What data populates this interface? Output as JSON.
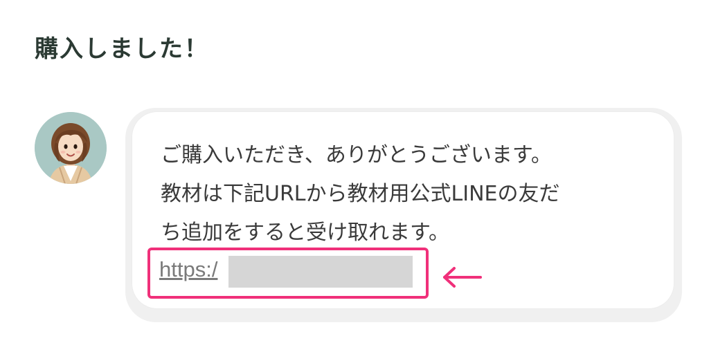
{
  "page": {
    "title": "購入しました！"
  },
  "avatar": {
    "icon": "person-avatar-icon",
    "background_color": "#a9c8c4"
  },
  "message": {
    "lines": [
      "ご購入いただき、ありがとうございます。",
      "教材は下記URLから教材用公式LINEの友だ",
      "ち追加をすると受け取れます。"
    ],
    "link_prefix": "https:/",
    "link_redacted": true
  },
  "annotation": {
    "highlight_color": "#f0307a",
    "arrow_icon": "left-arrow-icon"
  }
}
